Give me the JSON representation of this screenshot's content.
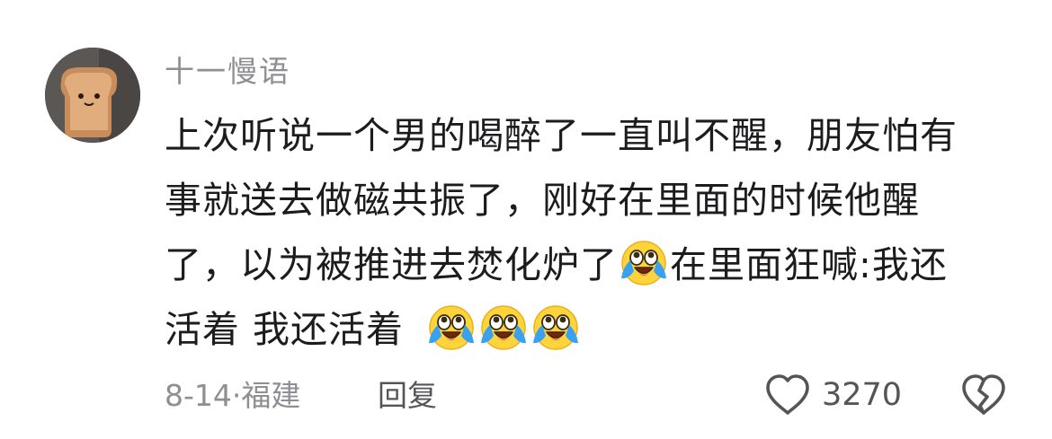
{
  "comment": {
    "username": "十一慢语",
    "avatar_icon": "toast-bread-avatar",
    "lines": [
      [
        "上次听说一个男的喝醉了一直叫不醒，朋友怕有"
      ],
      [
        "事就送去做磁共振了，刚好在里面的时候他醒"
      ],
      [
        "了，以为被推进去焚化炉了",
        "在里面狂喊:我还"
      ],
      [
        "活着 我还活着"
      ]
    ],
    "emoji_name": "crying-laughing-emoji",
    "date": "8-14",
    "separator": "·",
    "location": "福建",
    "reply_label": "回复",
    "like_count": "3270",
    "like_icon": "heart-outline-icon",
    "dislike_icon": "broken-heart-icon"
  },
  "colors": {
    "text_primary": "#1c1c1e",
    "text_secondary": "#8e8e93",
    "icon_gray": "#555558",
    "emoji_yellow": "#ffd43b",
    "emoji_tears": "#3aa0f0"
  }
}
